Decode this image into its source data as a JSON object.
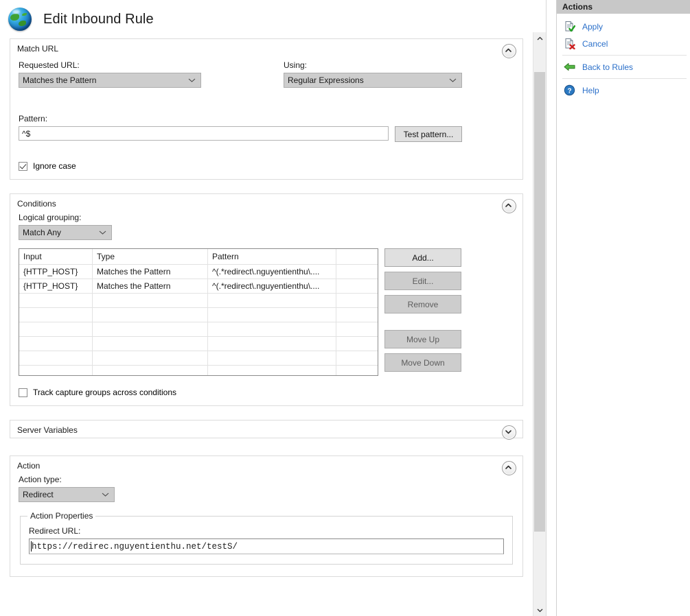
{
  "header": {
    "title": "Edit Inbound Rule",
    "icon": "globe-icon"
  },
  "match_url": {
    "section_title": "Match URL",
    "collapse_icon": "chevron-up-icon",
    "requested_url_label": "Requested URL:",
    "requested_url_value": "Matches the Pattern",
    "using_label": "Using:",
    "using_value": "Regular Expressions",
    "pattern_label": "Pattern:",
    "pattern_value": "^$",
    "test_pattern_button": "Test pattern...",
    "ignore_case_label": "Ignore case",
    "ignore_case_checked": true
  },
  "conditions": {
    "section_title": "Conditions",
    "collapse_icon": "chevron-up-icon",
    "logical_grouping_label": "Logical grouping:",
    "logical_grouping_value": "Match Any",
    "columns": [
      "Input",
      "Type",
      "Pattern",
      ""
    ],
    "rows": [
      {
        "input": "{HTTP_HOST}",
        "type": "Matches the Pattern",
        "pattern": "^(.*redirect\\.nguyentienthu\\....",
        "blank": ""
      },
      {
        "input": "{HTTP_HOST}",
        "type": "Matches the Pattern",
        "pattern": "^(.*redirect\\.nguyentienthu\\....",
        "blank": ""
      }
    ],
    "empty_row_count": 7,
    "buttons": [
      {
        "label": "Add...",
        "enabled": true
      },
      {
        "label": "Edit...",
        "enabled": false
      },
      {
        "label": "Remove",
        "enabled": false
      },
      {
        "label": "Move Up",
        "enabled": false
      },
      {
        "label": "Move Down",
        "enabled": false
      }
    ],
    "track_capture_label": "Track capture groups across conditions",
    "track_capture_checked": false
  },
  "server_variables": {
    "section_title": "Server Variables",
    "collapse_icon": "chevron-down-icon"
  },
  "action": {
    "section_title": "Action",
    "collapse_icon": "chevron-up-icon",
    "action_type_label": "Action type:",
    "action_type_value": "Redirect",
    "properties_legend": "Action Properties",
    "redirect_url_label": "Redirect URL:",
    "redirect_url_value": "https://redirec.nguyentienthu.net/testS/"
  },
  "actions_pane": {
    "title": "Actions",
    "items": [
      {
        "label": "Apply",
        "icon": "document-check-icon"
      },
      {
        "label": "Cancel",
        "icon": "document-x-icon"
      },
      {
        "label": "Back to Rules",
        "icon": "green-back-arrow-icon"
      },
      {
        "label": "Help",
        "icon": "help-question-icon"
      }
    ]
  },
  "scrollbar": {
    "up_icon": "chevron-up-icon",
    "down_icon": "chevron-down-icon"
  },
  "colors": {
    "link": "#2a6fc9",
    "panel_header": "#c8c8c8",
    "control_face": "#cdcdcd"
  }
}
